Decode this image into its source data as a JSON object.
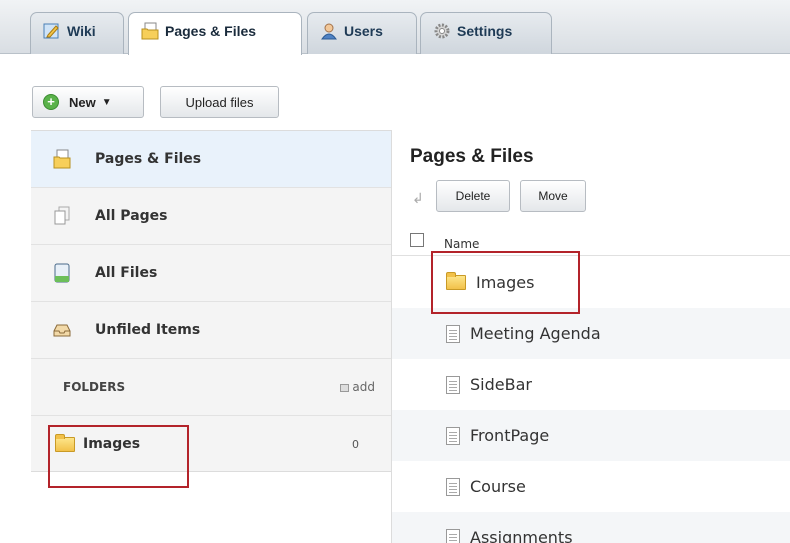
{
  "tabs": [
    {
      "label": "Wiki",
      "icon": "wiki-pencil-icon"
    },
    {
      "label": "Pages & Files",
      "icon": "pages-files-icon",
      "active": true
    },
    {
      "label": "Users",
      "icon": "users-icon"
    },
    {
      "label": "Settings",
      "icon": "settings-gear-icon"
    }
  ],
  "toolbar": {
    "new_label": "New",
    "upload_label": "Upload files"
  },
  "sidebar": {
    "items": [
      {
        "label": "Pages & Files",
        "icon": "pages-files-icon",
        "active": true
      },
      {
        "label": "All Pages",
        "icon": "all-pages-icon"
      },
      {
        "label": "All Files",
        "icon": "all-files-icon"
      },
      {
        "label": "Unfiled Items",
        "icon": "inbox-tray-icon"
      }
    ],
    "folders_heading": "FOLDERS",
    "add_label": "add",
    "folder": {
      "label": "Images",
      "count": "0",
      "icon": "folder-icon"
    }
  },
  "main": {
    "title": "Pages & Files",
    "delete_label": "Delete",
    "move_label": "Move",
    "column_name": "Name",
    "rows": [
      {
        "name": "Images",
        "icon": "folder-icon"
      },
      {
        "name": "Meeting Agenda",
        "icon": "document-icon"
      },
      {
        "name": "SideBar",
        "icon": "document-icon"
      },
      {
        "name": "FrontPage",
        "icon": "document-icon"
      },
      {
        "name": "Course",
        "icon": "document-icon"
      },
      {
        "name": "Assignments",
        "icon": "document-icon"
      }
    ]
  },
  "colors": {
    "highlight": "#b3232a",
    "sidebar_active": "#e9f2fb",
    "new_button_plus": "#5ab24a"
  }
}
